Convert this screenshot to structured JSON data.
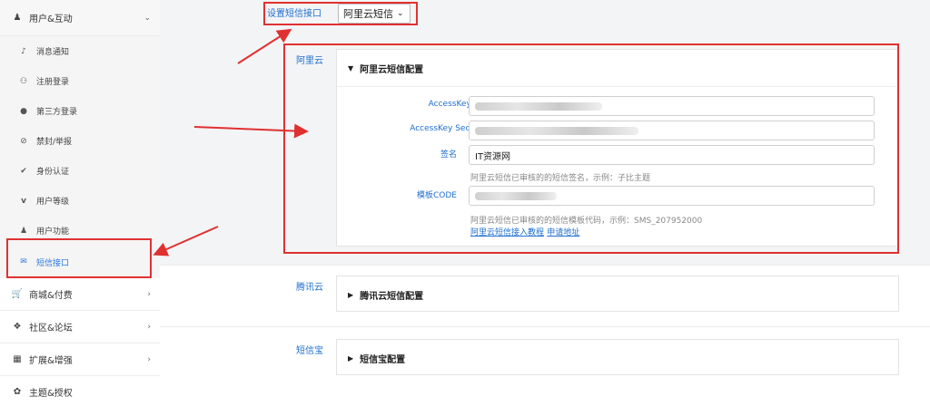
{
  "sidebar": {
    "top_group": {
      "label": "用户&互动",
      "icon": "user-icon"
    },
    "sub_items": [
      {
        "label": "消息通知",
        "icon": "bell-icon"
      },
      {
        "label": "注册登录",
        "icon": "user-plus-icon"
      },
      {
        "label": "第三方登录",
        "icon": "qq-icon"
      },
      {
        "label": "禁封/举报",
        "icon": "ban-icon"
      },
      {
        "label": "身份认证",
        "icon": "check-circle-icon"
      },
      {
        "label": "用户等级",
        "icon": "vip-icon"
      },
      {
        "label": "用户功能",
        "icon": "user-icon"
      },
      {
        "label": "短信接口",
        "icon": "chat-icon",
        "active": true
      }
    ],
    "groups": [
      {
        "label": "商城&付费",
        "icon": "cart-icon"
      },
      {
        "label": "社区&论坛",
        "icon": "compass-icon"
      },
      {
        "label": "扩展&增强",
        "icon": "puzzle-icon"
      },
      {
        "label": "主题&授权",
        "icon": "paw-icon"
      }
    ]
  },
  "main": {
    "sms_provider_label": "设置短信接口",
    "sms_provider_value": "阿里云短信",
    "aliyun": {
      "section_label": "阿里云",
      "panel_title": "阿里云短信配置",
      "fields": {
        "access_key_id_label": "AccessKey Id",
        "access_key_secret_label": "AccessKey Secret",
        "sign_label": "签名",
        "sign_value": "IT资源网",
        "sign_hint": "阿里云短信已审核的的短信签名，示例：子比主题",
        "template_label": "模板CODE",
        "template_hint": "阿里云短信已审核的的短信模板代码，示例：SMS_207952000",
        "link_tutorial": "阿里云短信接入教程",
        "link_apply": "申请地址"
      }
    },
    "tencent": {
      "section_label": "腾讯云",
      "panel_title": "腾讯云短信配置"
    },
    "smsbao": {
      "section_label": "短信宝",
      "panel_title": "短信宝配置"
    }
  },
  "colors": {
    "accent": "#1f6fd0",
    "highlight": "#e03131"
  }
}
